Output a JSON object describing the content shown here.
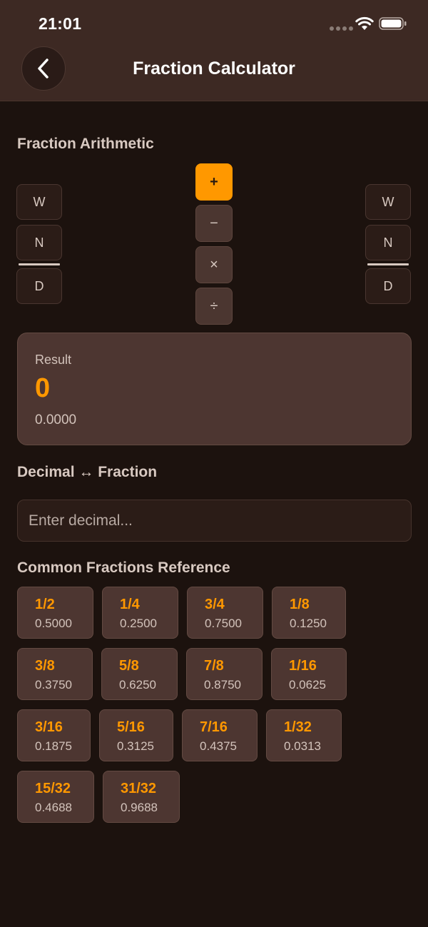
{
  "status_bar": {
    "time": "21:01"
  },
  "header": {
    "title": "Fraction Calculator"
  },
  "arithmetic": {
    "title": "Fraction Arithmetic",
    "left": {
      "whole": "W",
      "numerator": "N",
      "denominator": "D"
    },
    "right": {
      "whole": "W",
      "numerator": "N",
      "denominator": "D"
    },
    "operators": [
      "+",
      "−",
      "×",
      "÷"
    ],
    "active_operator": "+"
  },
  "result": {
    "label": "Result",
    "value": "0",
    "decimal": "0.0000"
  },
  "converter": {
    "title": "Decimal ↔ Fraction",
    "placeholder": "Enter decimal..."
  },
  "reference": {
    "title": "Common Fractions Reference",
    "items": [
      {
        "fraction": "1/2",
        "decimal": "0.5000"
      },
      {
        "fraction": "1/4",
        "decimal": "0.2500"
      },
      {
        "fraction": "3/4",
        "decimal": "0.7500"
      },
      {
        "fraction": "1/8",
        "decimal": "0.1250"
      },
      {
        "fraction": "3/8",
        "decimal": "0.3750"
      },
      {
        "fraction": "5/8",
        "decimal": "0.6250"
      },
      {
        "fraction": "7/8",
        "decimal": "0.8750"
      },
      {
        "fraction": "1/16",
        "decimal": "0.0625"
      },
      {
        "fraction": "3/16",
        "decimal": "0.1875"
      },
      {
        "fraction": "5/16",
        "decimal": "0.3125"
      },
      {
        "fraction": "7/16",
        "decimal": "0.4375"
      },
      {
        "fraction": "1/32",
        "decimal": "0.0313"
      },
      {
        "fraction": "15/32",
        "decimal": "0.4688"
      },
      {
        "fraction": "31/32",
        "decimal": "0.9688"
      }
    ]
  },
  "colors": {
    "accent": "#ff9800",
    "background": "#1c120e",
    "header": "#3d2923",
    "card": "#4d3631"
  }
}
